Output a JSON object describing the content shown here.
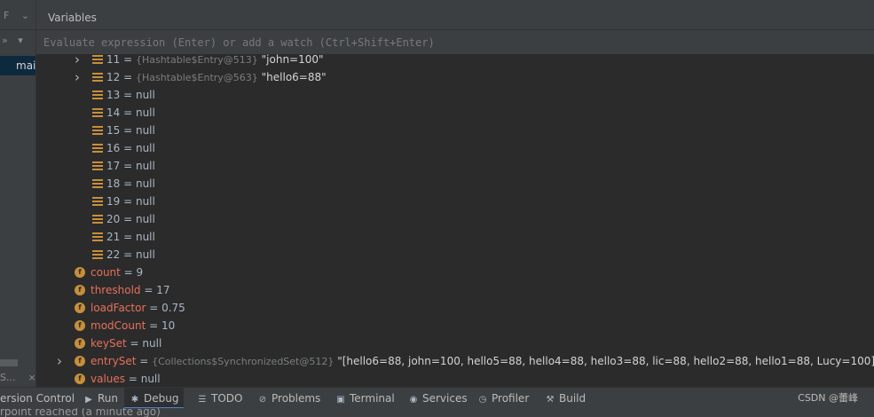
{
  "left_panel": {
    "frames_label": "F",
    "chevron": "»",
    "current_frame": "mai",
    "tab_label": "S...",
    "tab_close": "×"
  },
  "variables_panel": {
    "title": "Variables",
    "eval_placeholder": "Evaluate expression (Enter) or add a watch (Ctrl+Shift+Enter)"
  },
  "tree": {
    "rows": [
      {
        "type": "array",
        "expandable": true,
        "name": "11",
        "ref": "{Hashtable$Entry@513}",
        "value": "\"john=100\""
      },
      {
        "type": "array",
        "expandable": true,
        "name": "12",
        "ref": "{Hashtable$Entry@563}",
        "value": "\"hello6=88\""
      },
      {
        "type": "array",
        "expandable": false,
        "name": "13",
        "value": "null"
      },
      {
        "type": "array",
        "expandable": false,
        "name": "14",
        "value": "null"
      },
      {
        "type": "array",
        "expandable": false,
        "name": "15",
        "value": "null"
      },
      {
        "type": "array",
        "expandable": false,
        "name": "16",
        "value": "null"
      },
      {
        "type": "array",
        "expandable": false,
        "name": "17",
        "value": "null"
      },
      {
        "type": "array",
        "expandable": false,
        "name": "18",
        "value": "null"
      },
      {
        "type": "array",
        "expandable": false,
        "name": "19",
        "value": "null"
      },
      {
        "type": "array",
        "expandable": false,
        "name": "20",
        "value": "null"
      },
      {
        "type": "array",
        "expandable": false,
        "name": "21",
        "value": "null"
      },
      {
        "type": "array",
        "expandable": false,
        "name": "22",
        "value": "null"
      },
      {
        "type": "field",
        "expandable": false,
        "name": "count",
        "value": "9"
      },
      {
        "type": "field",
        "expandable": false,
        "name": "threshold",
        "value": "17"
      },
      {
        "type": "field",
        "expandable": false,
        "name": "loadFactor",
        "value": "0.75"
      },
      {
        "type": "field",
        "expandable": false,
        "name": "modCount",
        "value": "10"
      },
      {
        "type": "field",
        "expandable": false,
        "name": "keySet",
        "value": "null"
      },
      {
        "type": "field",
        "expandable": true,
        "name": "entrySet",
        "ref": "{Collections$SynchronizedSet@512}",
        "value": "\"[hello6=88, john=100, hello5=88, hello4=88, hello3=88, lic=88, hello2=88, hello1=88, Lucy=100]\""
      },
      {
        "type": "field",
        "expandable": false,
        "name": "values",
        "value": "null"
      }
    ]
  },
  "bottom_tabs": [
    {
      "label": "ersion Control",
      "icon": ""
    },
    {
      "label": "Run",
      "icon": "run-icon"
    },
    {
      "label": "Debug",
      "icon": "debug-icon",
      "active": true
    },
    {
      "label": "TODO",
      "icon": "todo-icon"
    },
    {
      "label": "Problems",
      "icon": "problems-icon"
    },
    {
      "label": "Terminal",
      "icon": "terminal-icon"
    },
    {
      "label": "Services",
      "icon": "services-icon"
    },
    {
      "label": "Profiler",
      "icon": "profiler-icon"
    },
    {
      "label": "Build",
      "icon": "build-icon"
    }
  ],
  "watermark": "CSDN @蕾峰",
  "status": "rpoint reached (a minute ago)",
  "colors": {
    "field_name": "#e8705a",
    "icon_orange": "#c88f3a",
    "accent": "#4a88c7"
  }
}
